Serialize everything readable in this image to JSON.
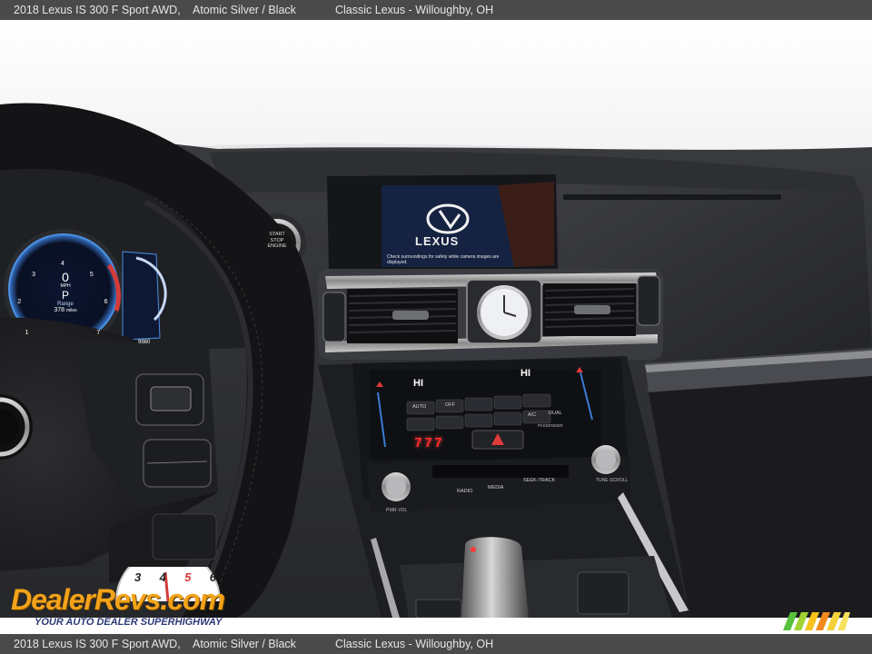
{
  "caption": {
    "car": "2018 Lexus IS 300 F Sport AWD,",
    "color": "Atomic Silver / Black",
    "dealer": "Classic Lexus - Willoughby, OH"
  },
  "screen": {
    "brand": "LEXUS",
    "warning_line1": "Check surroundings for safety while camera images are displayed.",
    "warning_line2": ""
  },
  "gauge": {
    "speed": "0",
    "speed_unit": "MPH",
    "gear": "P",
    "range_label": "Range",
    "range_value": "378",
    "range_unit": "miles",
    "odometer": "9980",
    "ticks": [
      "1",
      "2",
      "3",
      "4",
      "5",
      "6",
      "7"
    ]
  },
  "climate": {
    "left_temp": "HI",
    "right_temp": "HI",
    "buttons": [
      "AUTO",
      "OFF",
      "A/C",
      "DUAL"
    ],
    "passenger_label": "PASSENGER",
    "display_digits": "777",
    "media_buttons": [
      "RADIO",
      "MEDIA",
      "SEEK-TRACK"
    ],
    "pwr_vol": "PWR·VOL",
    "tune_scroll": "TUNE·SCROLL"
  },
  "start_button": {
    "line1": "START",
    "line2": "STOP",
    "line3": "ENGINE"
  },
  "watermark": {
    "brand": "DealerRevs.com",
    "tagline": "YOUR AUTO DEALER SUPERHIGHWAY",
    "gauge_digits": [
      "3",
      "4",
      "5",
      "6"
    ]
  },
  "colors": {
    "caption_bar": "#4a4a4a",
    "logo_orange": "#f2a319",
    "logo_blue": "#2b3a77",
    "climate_red": "#ff2a2a",
    "gauge_blue": "#3a7bd5"
  }
}
